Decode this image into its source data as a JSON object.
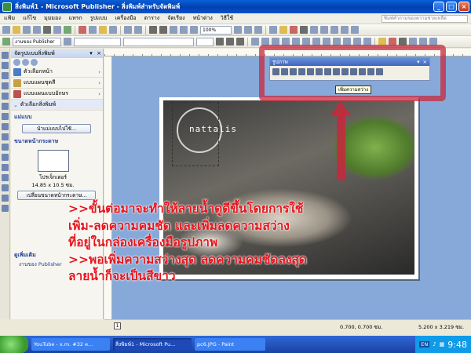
{
  "window": {
    "title": "สิ่งพิมพ์1 - Microsoft Publisher - สิ่งพิมพ์สำหรับจัดพิมพ์"
  },
  "menu": {
    "items": [
      "แฟ้ม",
      "แก้ไข",
      "มุมมอง",
      "แทรก",
      "รูปแบบ",
      "เครื่องมือ",
      "ตาราง",
      "จัดเรียง",
      "หน้าต่าง",
      "วิธีใช้"
    ],
    "help_placeholder": "พิมพ์คำถามของความช่วยเหลือ"
  },
  "toolbar": {
    "zoom": "100%",
    "task_label": "งานของ Publisher"
  },
  "taskpane": {
    "title": "จัดรูปแบบสิ่งพิมพ์",
    "rows": [
      "ตัวเลือกหน้า",
      "แบบแผนชุดสี",
      "แบบแผนแบบอักษร"
    ],
    "section_label": "ตัวเลือกสิ่งพิมพ์",
    "template_header": "แม่แบบ",
    "template_button": "นำแม่แบบไปใช้...",
    "page_size_header": "ขนาดหน้ากระดาษ",
    "page_size_name": "โปรเจ็กเตอร์",
    "page_size_dims": "14.85 x 10.5 ซม.",
    "change_size_button": "เปลี่ยนขนาดหน้ากระดาษ...",
    "see_also": "ดูเพิ่มเติม",
    "see_also_link": "งานของ Publisher"
  },
  "picture_toolbar": {
    "title": "รูปภาพ",
    "tooltip": "เพิ่มความสว่าง"
  },
  "image": {
    "watermark_text": "nattalis"
  },
  "annotation": {
    "lines": [
      ">>ขั้นต่อมาจะทำให้ลายน้ำดูดีขึ้นโดยการใช้",
      "เพิ่ม-ลดความคมชัด และเพิ่มลดความสว่าง",
      "ที่อยู่ในกล่องเครื่องมือรูปภาพ",
      ">>พอเพิ่มความสว่างสุด ลดความคมชัดลงสุด",
      "ลายน้ำก็จะเป็นสีขาว"
    ]
  },
  "status": {
    "page": "1",
    "position": "0.700, 0.700 ซม.",
    "size": "5.200 x 3.219 ซม."
  },
  "taskbar": {
    "tasks": [
      "YouTube - x.m. #32 e...",
      "สิ่งพิมพ์1 - Microsoft Pu...",
      "pc6.JPG - Paint"
    ],
    "lang": "EN",
    "clock": "9:48"
  },
  "colors": {
    "annotation": "#e8141b",
    "callout": "#c8283c",
    "workspace": "#87a9d9"
  }
}
